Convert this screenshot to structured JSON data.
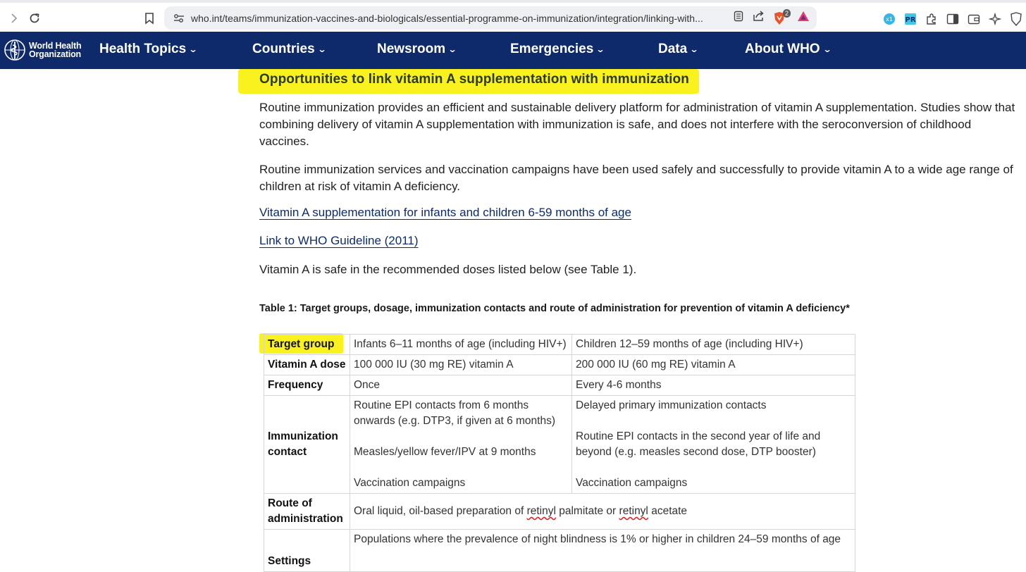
{
  "browser": {
    "url": "who.int/teams/immunization-vaccines-and-biologicals/essential-programme-on-immunization/integration/linking-with...",
    "brave_badge": "2"
  },
  "nav": {
    "logo_line1": "World Health",
    "logo_line2": "Organization",
    "items": [
      "Health Topics",
      "Countries",
      "Newsroom",
      "Emergencies",
      "Data",
      "About WHO"
    ]
  },
  "article": {
    "heading": "Opportunities to link vitamin A supplementation with immunization",
    "para1": "Routine immunization provides an efficient and sustainable delivery platform for administration of vitamin A supplementation. Studies show that combining delivery of vitamin A supplementation with immunization is safe, and does not interfere with the seroconversion of childhood vaccines.",
    "para2": "Routine immunization services and vaccination campaigns have been used safely and successfully to provide vitamin A to a wide age range of children at risk of vitamin A deficiency.",
    "link1": "Vitamin A supplementation for infants and children 6-59 months of age",
    "link2": "Link to WHO Guideline (2011)",
    "para3": "Vitamin A is safe in the recommended doses listed below (see Table 1).",
    "table_caption": "Table 1: Target groups, dosage, immunization contacts and route of administration for prevention of vitamin A deficiency*"
  },
  "table": {
    "rows": [
      {
        "label": "Target group",
        "c1": "Infants 6–11 months of age (including HIV+)",
        "c2": "Children 12–59 months of age (including HIV+)"
      },
      {
        "label": "Vitamin A dose",
        "c1": "100 000 IU (30 mg RE) vitamin A",
        "c2": "200 000 IU (60 mg RE) vitamin A"
      },
      {
        "label": "Frequency",
        "c1": "Once",
        "c2": "Every 4-6 months"
      },
      {
        "label": "Immunization contact",
        "c1": "Routine EPI contacts from 6 months onwards (e.g. DTP3, if given at 6 months)\n\nMeasles/yellow fever/IPV at 9 months\n\nVaccination campaigns",
        "c2": "Delayed primary immunization contacts\n\nRoutine EPI contacts in the second year of life and beyond (e.g. measles second dose, DTP booster)\n\nVaccination campaigns"
      },
      {
        "label": "Route of administration",
        "c1_a": "Oral liquid, oil-based preparation of ",
        "c1_b": "retinyl",
        "c1_c": " palmitate or ",
        "c1_d": "retinyl",
        "c1_e": " acetate"
      },
      {
        "label": "Settings",
        "c1": "Populations where the prevalence of night blindness is 1% or higher in children 24–59 months of age"
      }
    ]
  }
}
